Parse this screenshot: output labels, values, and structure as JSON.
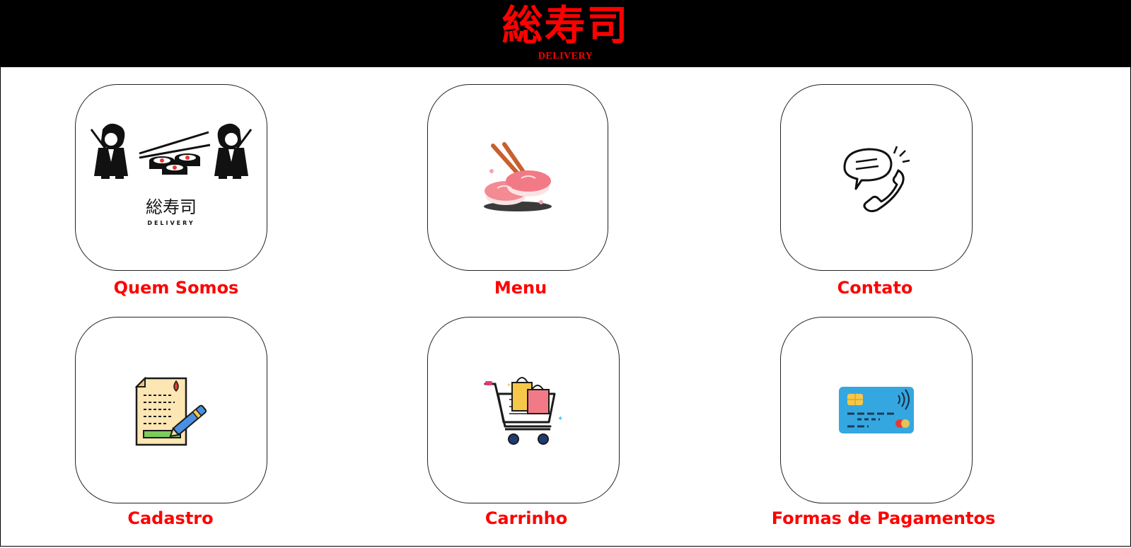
{
  "header": {
    "brand_title": "総寿司",
    "brand_subtitle": "DELIVERY"
  },
  "tiles": [
    {
      "label": "Quem Somos",
      "icon": "about-us-logo-icon",
      "logo_title": "総寿司",
      "logo_subtitle": "DELIVERY"
    },
    {
      "label": "Menu",
      "icon": "sushi-icon"
    },
    {
      "label": "Contato",
      "icon": "phone-chat-icon"
    },
    {
      "label": "Cadastro",
      "icon": "registration-form-icon"
    },
    {
      "label": "Carrinho",
      "icon": "shopping-cart-icon"
    },
    {
      "label": "Formas de Pagamentos",
      "icon": "credit-card-icon"
    }
  ],
  "colors": {
    "accent": "#ff0000",
    "header_bg": "#000000",
    "page_bg": "#ffffff"
  }
}
